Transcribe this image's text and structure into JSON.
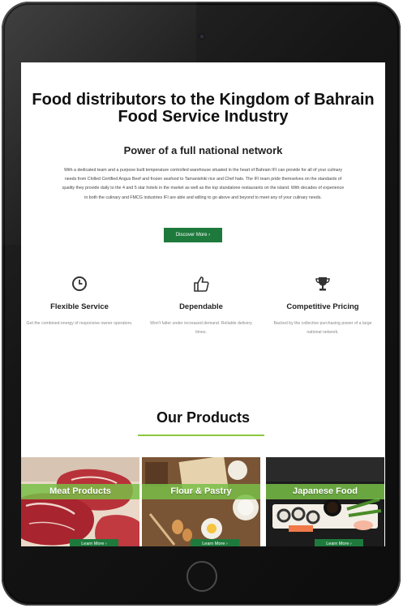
{
  "hero": {
    "title": "Food distributors to the Kingdom of Bahrain Food Service Industry",
    "subtitle": "Power of a full national network",
    "body": "With a dedicated team and a purpose built temperature controlled warehouse situated in the heart of Bahrain IFI can provide for all of your culinary needs from Chilled Certified Angus Beef and frozen seafood to Tamanishiki rice and Chef hats. The IFI team pride themselves on the standards of quality they provide daily to the 4 and 5 star hotels in the market as well as the top standalone restaurants on the island. With decades of experience in both the culinary and FMCG industries IFI are able and willing to go above and beyond to meet any of your culinary needs.",
    "cta_label": "Discover More  ›"
  },
  "features": [
    {
      "icon": "clock-icon",
      "title": "Flexible Service",
      "description": "Get the combined energy of responsive owner operators."
    },
    {
      "icon": "thumbs-up-icon",
      "title": "Dependable",
      "description": "Won't falter under increased demand. Reliable delivery times."
    },
    {
      "icon": "trophy-icon",
      "title": "Competitive Pricing",
      "description": "Backed by the collective purchasing power of a large national network."
    }
  ],
  "products": {
    "title": "Our Products",
    "items": [
      {
        "name": "Meat Products",
        "link_label": "Learn More  ›"
      },
      {
        "name": "Flour & Pastry",
        "link_label": "Learn More  ›"
      },
      {
        "name": "Japanese Food",
        "link_label": "Learn More  ›"
      }
    ]
  },
  "colors": {
    "accent_green": "#1e7a3c",
    "band_green": "#78be46",
    "underline_green": "#8cc63f",
    "device_frame": "#151515"
  }
}
